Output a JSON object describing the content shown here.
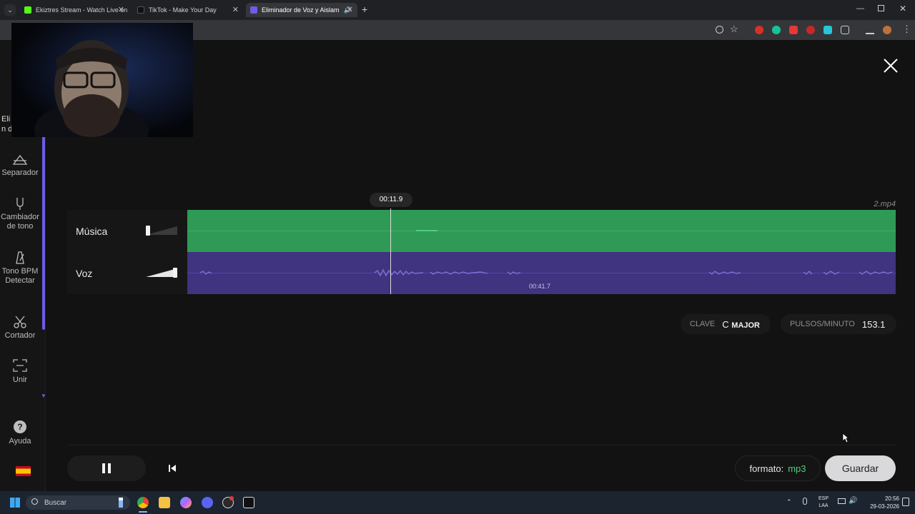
{
  "browser": {
    "tabs": [
      {
        "title": "Ekiztres Stream - Watch Live on",
        "favicon_color": "#53fc18"
      },
      {
        "title": "TikTok - Make Your Day",
        "favicon_color": "#111111"
      },
      {
        "title": "Eliminador de Voz y Aislam",
        "favicon_color": "#6c5ce7"
      }
    ]
  },
  "sidebar": {
    "partial_title": "Elin d",
    "items": [
      {
        "label": "Separador"
      },
      {
        "label": "Cambiador de tono"
      },
      {
        "label": "Tono BPM Detectar"
      },
      {
        "label": "Cortador"
      },
      {
        "label": "Unir"
      },
      {
        "label": "Ayuda"
      }
    ]
  },
  "editor": {
    "current_time": "00:11.9",
    "file_name": "2.mp4",
    "tracks": [
      {
        "name": "Música",
        "volume": 0.0,
        "color": "#2e9a55"
      },
      {
        "name": "Voz",
        "volume": 1.0,
        "color": "#40337f"
      }
    ],
    "voz_marker_time": "00:41.7",
    "key_label": "CLAVE",
    "key_note": "C",
    "key_mode": "MAJOR",
    "bpm_label": "PULSOS/MINUTO",
    "bpm_value": "153.1",
    "format_label": "formato:",
    "format_value": "mp3",
    "save_label": "Guardar"
  },
  "taskbar": {
    "search_placeholder": "Buscar",
    "lang_top": "ESP",
    "lang_bottom": "LAA",
    "time": "20:56",
    "date": "29-03-2026"
  }
}
